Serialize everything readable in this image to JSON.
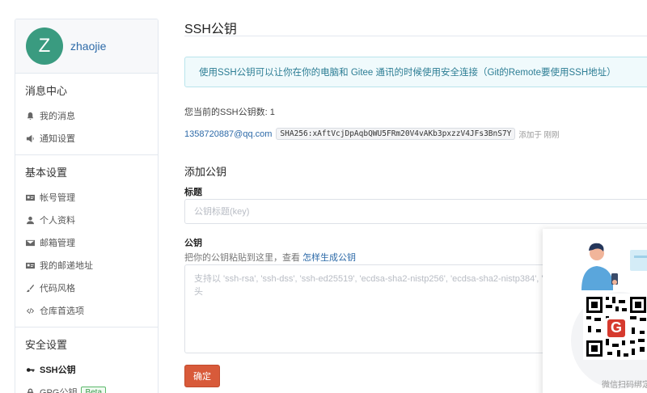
{
  "user": {
    "avatar_letter": "Z",
    "name": "zhaojie"
  },
  "sidebar": {
    "sections": [
      {
        "title": "消息中心",
        "items": [
          {
            "label": "我的消息",
            "icon": "bell-icon"
          },
          {
            "label": "通知设置",
            "icon": "speaker-icon"
          }
        ]
      },
      {
        "title": "基本设置",
        "items": [
          {
            "label": "帐号管理",
            "icon": "id-card-icon"
          },
          {
            "label": "个人资料",
            "icon": "user-icon"
          },
          {
            "label": "邮箱管理",
            "icon": "envelope-icon"
          },
          {
            "label": "我的邮递地址",
            "icon": "address-card-icon"
          },
          {
            "label": "代码风格",
            "icon": "brush-icon"
          },
          {
            "label": "仓库首选项",
            "icon": "code-icon"
          }
        ]
      },
      {
        "title": "安全设置",
        "items": [
          {
            "label": "SSH公钥",
            "icon": "key-icon",
            "active": true
          },
          {
            "label": "GPG公钥",
            "icon": "lock-icon",
            "badge": "Beta"
          }
        ]
      }
    ]
  },
  "main": {
    "title": "SSH公钥",
    "info": "使用SSH公钥可以让你在你的电脑和 Gitee 通讯的时候使用安全连接（Git的Remote要使用SSH地址）",
    "key_count": "您当前的SSH公钥数: 1",
    "key": {
      "email": "1358720887@qq.com",
      "fingerprint": "SHA256:xAftVcjDpAqbQWU5FRm20V4vAKb3pxzzV4JFs3BnS7Y",
      "added": "添加于 刚刚"
    },
    "add_title": "添加公钥",
    "title_label": "标题",
    "title_placeholder": "公钥标题(key)",
    "key_label": "公钥",
    "key_hint": "把你的公钥粘贴到这里，查看",
    "key_hint_link": "怎样生成公钥",
    "key_placeholder": "支持以 'ssh-rsa', 'ssh-dss', 'ssh-ed25519', 'ecdsa-sha2-nistp256', 'ecdsa-sha2-nistp384', 'ecdsa-sha2-nistp521' 开头",
    "submit": "确定"
  },
  "popup": {
    "caption": "微信扫码绑定",
    "logo_letter": "G"
  },
  "colors": {
    "accent": "#d85a3a",
    "link": "#2d6aa8",
    "avatar": "#3a9b80",
    "info_bg": "#f0fafc",
    "badge": "#5bb86a"
  }
}
